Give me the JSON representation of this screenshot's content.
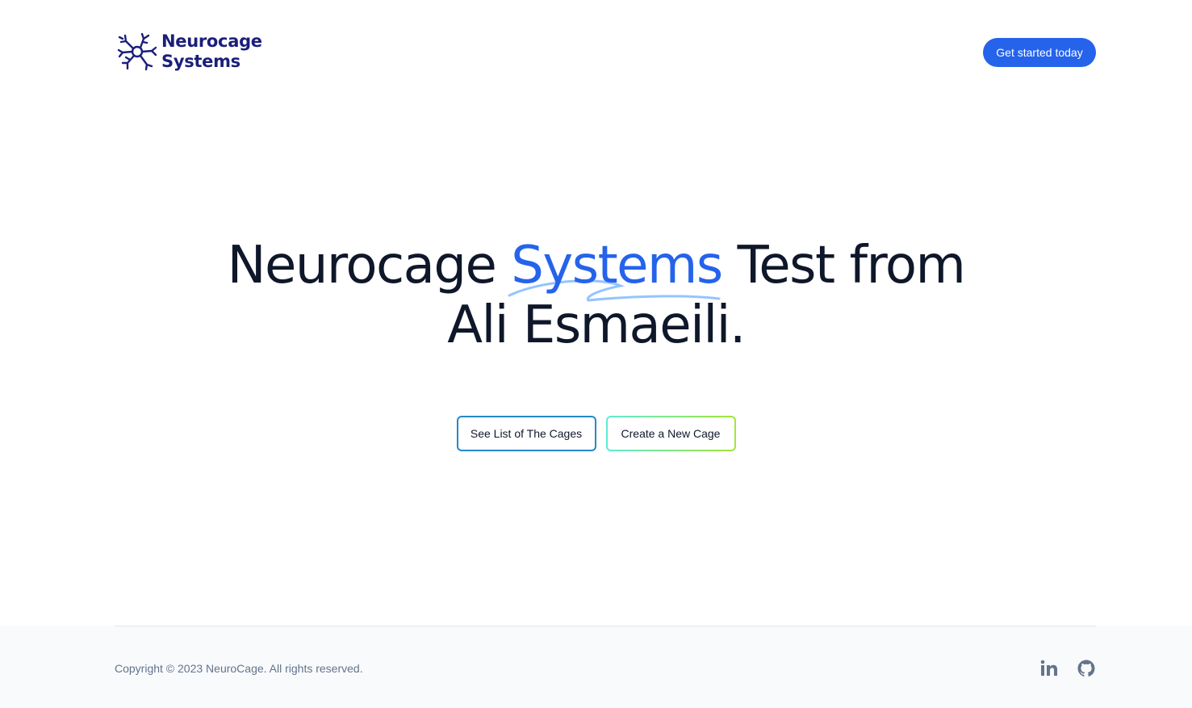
{
  "header": {
    "logo": {
      "line1": "Neurocage",
      "line2": "Systems",
      "icon": "neuron-icon",
      "color": "#1a1f7a"
    },
    "cta_label": "Get started today"
  },
  "hero": {
    "title_part1": "Neurocage ",
    "title_accent": "Systems",
    "title_part2": " Test from",
    "title_line2": "Ali Esmaeili.",
    "accent_color": "#2563eb",
    "buttons": {
      "list_label": "See List of The Cages",
      "create_label": "Create a New Cage"
    }
  },
  "footer": {
    "copyright": "Copyright © 2023 NeuroCage. All rights reserved.",
    "social": [
      {
        "icon": "linkedin-icon"
      },
      {
        "icon": "github-icon"
      }
    ]
  },
  "colors": {
    "primary": "#2563eb",
    "text": "#0f172a",
    "muted": "#64748b",
    "footer_bg": "#f8fafc"
  }
}
